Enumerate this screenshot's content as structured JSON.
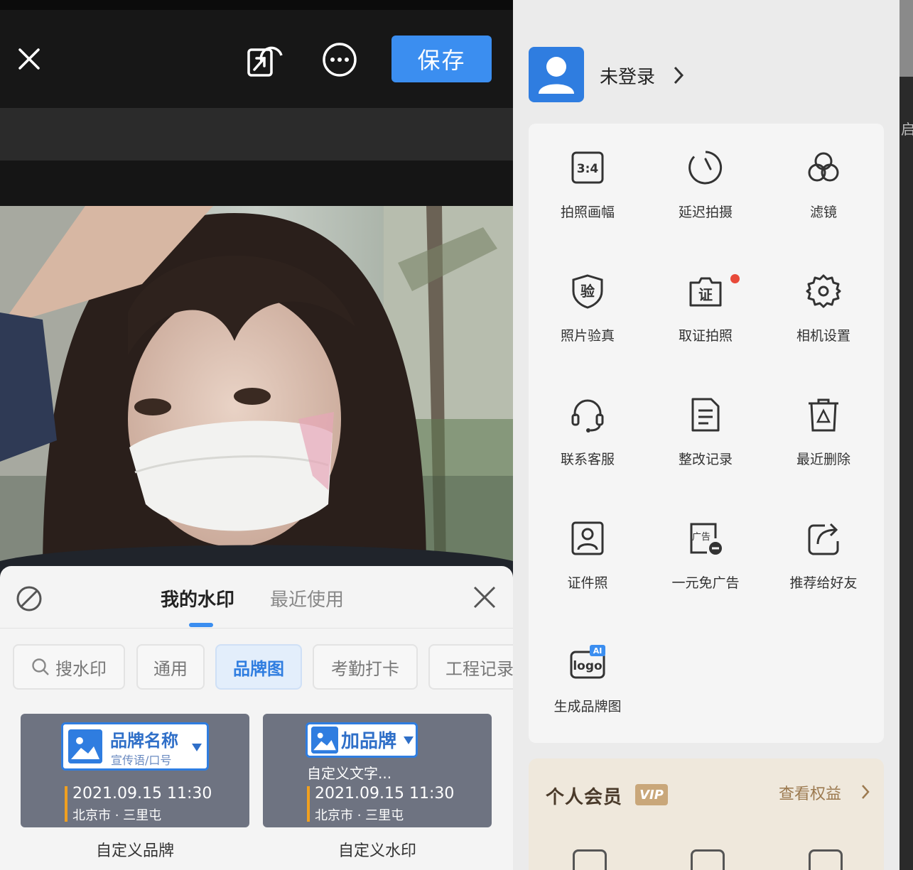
{
  "editor": {
    "save_label": "保存",
    "icons": {
      "close": "close-icon",
      "share": "share-icon",
      "more": "more-icon"
    }
  },
  "watermark_sheet": {
    "tabs": {
      "mine": "我的水印",
      "recent": "最近使用"
    },
    "search_label": "搜水印",
    "categories": [
      "通用",
      "品牌图",
      "考勤打卡",
      "工程记录"
    ],
    "active_category": "品牌图",
    "cards": [
      {
        "brand": "品牌名称",
        "slogan": "宣传语/口号",
        "datetime": "2021.09.15  11:30",
        "location": "北京市 · 三里屯",
        "caption": "自定义品牌"
      },
      {
        "brand": "加品牌",
        "custom_text": "自定义文字...",
        "datetime": "2021.09.15  11:30",
        "location": "北京市 · 三里屯",
        "caption": "自定义水印"
      }
    ]
  },
  "side_menu": {
    "login_label": "未登录",
    "items": [
      {
        "label": "拍照画幅",
        "icon": "aspect-ratio-icon",
        "icon_text": "3:4"
      },
      {
        "label": "延迟拍摄",
        "icon": "timer-icon"
      },
      {
        "label": "滤镜",
        "icon": "filter-icon"
      },
      {
        "label": "照片验真",
        "icon": "verify-shield-icon",
        "icon_text": "验"
      },
      {
        "label": "取证拍照",
        "icon": "evidence-camera-icon",
        "icon_text": "证"
      },
      {
        "label": "相机设置",
        "icon": "gear-icon"
      },
      {
        "label": "联系客服",
        "icon": "headset-icon"
      },
      {
        "label": "整改记录",
        "icon": "document-icon"
      },
      {
        "label": "最近删除",
        "icon": "trash-icon"
      },
      {
        "label": "证件照",
        "icon": "id-photo-icon"
      },
      {
        "label": "一元免广告",
        "icon": "remove-ads-icon",
        "icon_text": "广告"
      },
      {
        "label": "推荐给好友",
        "icon": "share-friend-icon"
      },
      {
        "label": "生成品牌图",
        "icon": "ai-logo-icon",
        "icon_text": "logo",
        "badge_text": "AI"
      }
    ],
    "vip": {
      "title": "个人会员",
      "badge": "VIP",
      "link": "查看权益"
    }
  },
  "edge": {
    "char": "启"
  },
  "colors": {
    "accent": "#3b8ef0",
    "dark_bg": "#171717",
    "vip_gold": "#c9a77a",
    "alert": "#e84a3a"
  }
}
